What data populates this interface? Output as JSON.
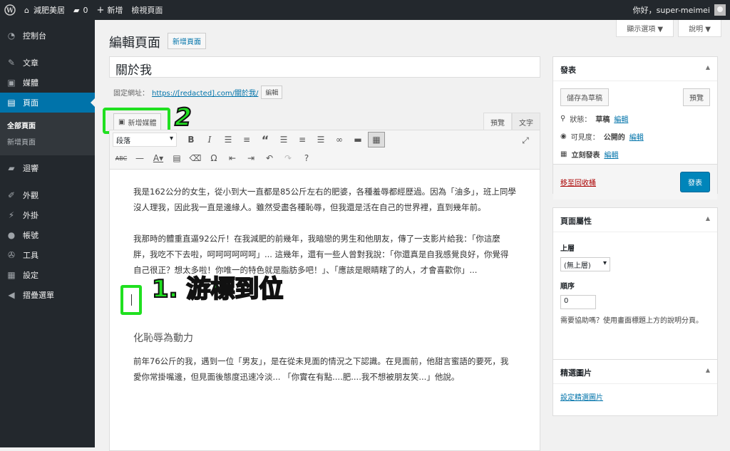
{
  "adminbar": {
    "site_name": "減肥美居",
    "comments_count": "0",
    "new_label": "新增",
    "view_page": "檢視頁面",
    "greeting": "你好，super-meimei"
  },
  "sidebar": {
    "items": [
      {
        "label": "控制台",
        "icon": "dashboard-icon"
      },
      {
        "label": "文章",
        "icon": "pin-icon"
      },
      {
        "label": "媒體",
        "icon": "media-icon"
      },
      {
        "label": "頁面",
        "icon": "page-icon"
      },
      {
        "label": "迴響",
        "icon": "comment-icon"
      },
      {
        "label": "外觀",
        "icon": "brush-icon"
      },
      {
        "label": "外掛",
        "icon": "plugin-icon"
      },
      {
        "label": "帳號",
        "icon": "user-icon"
      },
      {
        "label": "工具",
        "icon": "wrench-icon"
      },
      {
        "label": "設定",
        "icon": "settings-icon"
      },
      {
        "label": "摺疊選單",
        "icon": "collapse-icon"
      }
    ],
    "submenu": [
      "全部頁面",
      "新增頁面"
    ]
  },
  "header": {
    "screen_options": "顯示選項 ▼",
    "help": "說明 ▼",
    "title": "編輯頁面",
    "add_new": "新增頁面"
  },
  "post": {
    "title": "關於我",
    "permalink_label": "固定網址：",
    "permalink_url": "https://[redacted].com/關於我/",
    "edit_btn": "編輯"
  },
  "editor": {
    "add_media": "新增媒體",
    "annotation_2": "2",
    "tab_visual": "預覽",
    "tab_text": "文字",
    "format_select": "段落",
    "annotation_1": "1. 游標到位",
    "paragraphs": [
      "我是162公分的女生，從小到大一直都是85公斤左右的肥婆，各種羞辱都經歷過。因為「油多」，班上同學沒人理我，因此我一直是邊緣人。雖然受盡各種恥辱，但我還是活在自己的世界裡，直到幾年前。",
      "我那時的體重直逼92公斤！在我減肥的前幾年，我暗戀的男生和他朋友，傳了一支影片給我：「你這麼胖，我吃不下去啦，呵呵呵呵呵呵」... 這幾年，還有一些人曾對我說：「你還真是自我感覺良好，你覺得自己很正？想太多啦！你唯一的特色就是脂肪多吧！」、「應該是眼睛瞎了的人，才會喜歡你」...",
      "前年76公斤的我，遇到一位「男友」，是在從未見面的情況之下認識。在見面前，他甜言蜜語的要死，我愛你常掛嘴邊，但見面後態度迅速冷淡... 「你實在有點....肥....我不想被朋友笑...」他說。"
    ],
    "subheading": "化恥辱為動力"
  },
  "publish": {
    "title": "發表",
    "save_draft": "儲存為草稿",
    "preview": "預覽",
    "status_label": "狀態：",
    "status_value": "草稿",
    "visibility_label": "可見度：",
    "visibility_value": "公開的",
    "schedule_label": "立刻發表",
    "edit_link": "編輯",
    "trash": "移至回收桶",
    "publish_btn": "發表"
  },
  "attributes": {
    "title": "頁面屬性",
    "parent_label": "上層",
    "parent_value": "(無上層)",
    "order_label": "順序",
    "order_value": "0",
    "help": "需要協助嗎？使用畫面標題上方的說明分頁。"
  },
  "featured": {
    "title": "精選圖片",
    "link": "設定精選圖片"
  }
}
